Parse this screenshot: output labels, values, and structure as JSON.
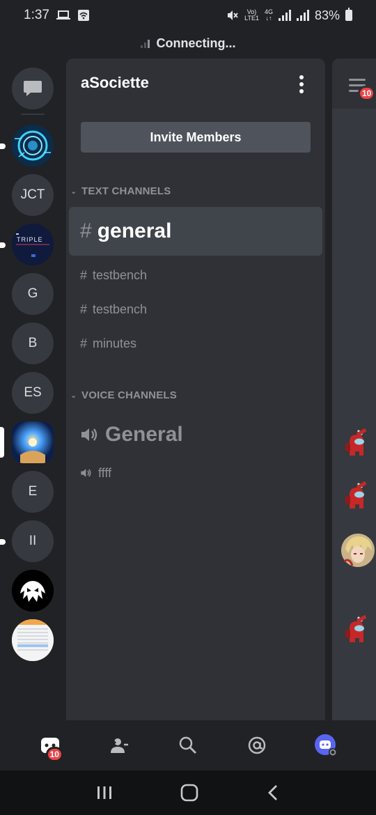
{
  "status_bar": {
    "time": "1:37",
    "network_label_top": "Vo)",
    "network_label_bottom": "LTE1",
    "network_gen": "4G",
    "battery": "83%"
  },
  "connection": {
    "status": "Connecting..."
  },
  "servers": [
    {
      "name": "server-1",
      "type": "image",
      "icon": "cyber-circle",
      "unread": true
    },
    {
      "name": "JCT",
      "type": "text",
      "label": "JCT"
    },
    {
      "name": "the-triple-project",
      "type": "image",
      "icon": "triple-project-logo",
      "logo_text": "TRIPLE",
      "unread": true
    },
    {
      "name": "G",
      "type": "text",
      "label": "G"
    },
    {
      "name": "B",
      "type": "text",
      "label": "B"
    },
    {
      "name": "ES",
      "type": "text",
      "label": "ES"
    },
    {
      "name": "aSociette",
      "type": "image",
      "icon": "light-orb-art",
      "selected": true
    },
    {
      "name": "E",
      "type": "text",
      "label": "E"
    },
    {
      "name": "II",
      "type": "text",
      "label": "II",
      "unread": true
    },
    {
      "name": "server-venom",
      "type": "image",
      "icon": "venom-spider-logo"
    },
    {
      "name": "server-doc",
      "type": "image",
      "icon": "spreadsheet-thumbnail"
    }
  ],
  "server_panel": {
    "name": "aSociette",
    "invite_label": "Invite Members",
    "text_category": "TEXT CHANNELS",
    "text_channels": [
      "general",
      "testbench",
      "testbench",
      "minutes"
    ],
    "voice_category": "VOICE CHANNELS",
    "voice_channels": [
      "General",
      "ffff"
    ]
  },
  "members_badge": "10",
  "bottom_nav": {
    "home_badge": "10",
    "items": [
      "home",
      "friends",
      "search",
      "mentions",
      "profile"
    ]
  },
  "colors": {
    "background": "#202225",
    "panel": "#2f3136",
    "selected": "#40444b",
    "badge": "#ed4245",
    "accent": "#5865f2"
  }
}
